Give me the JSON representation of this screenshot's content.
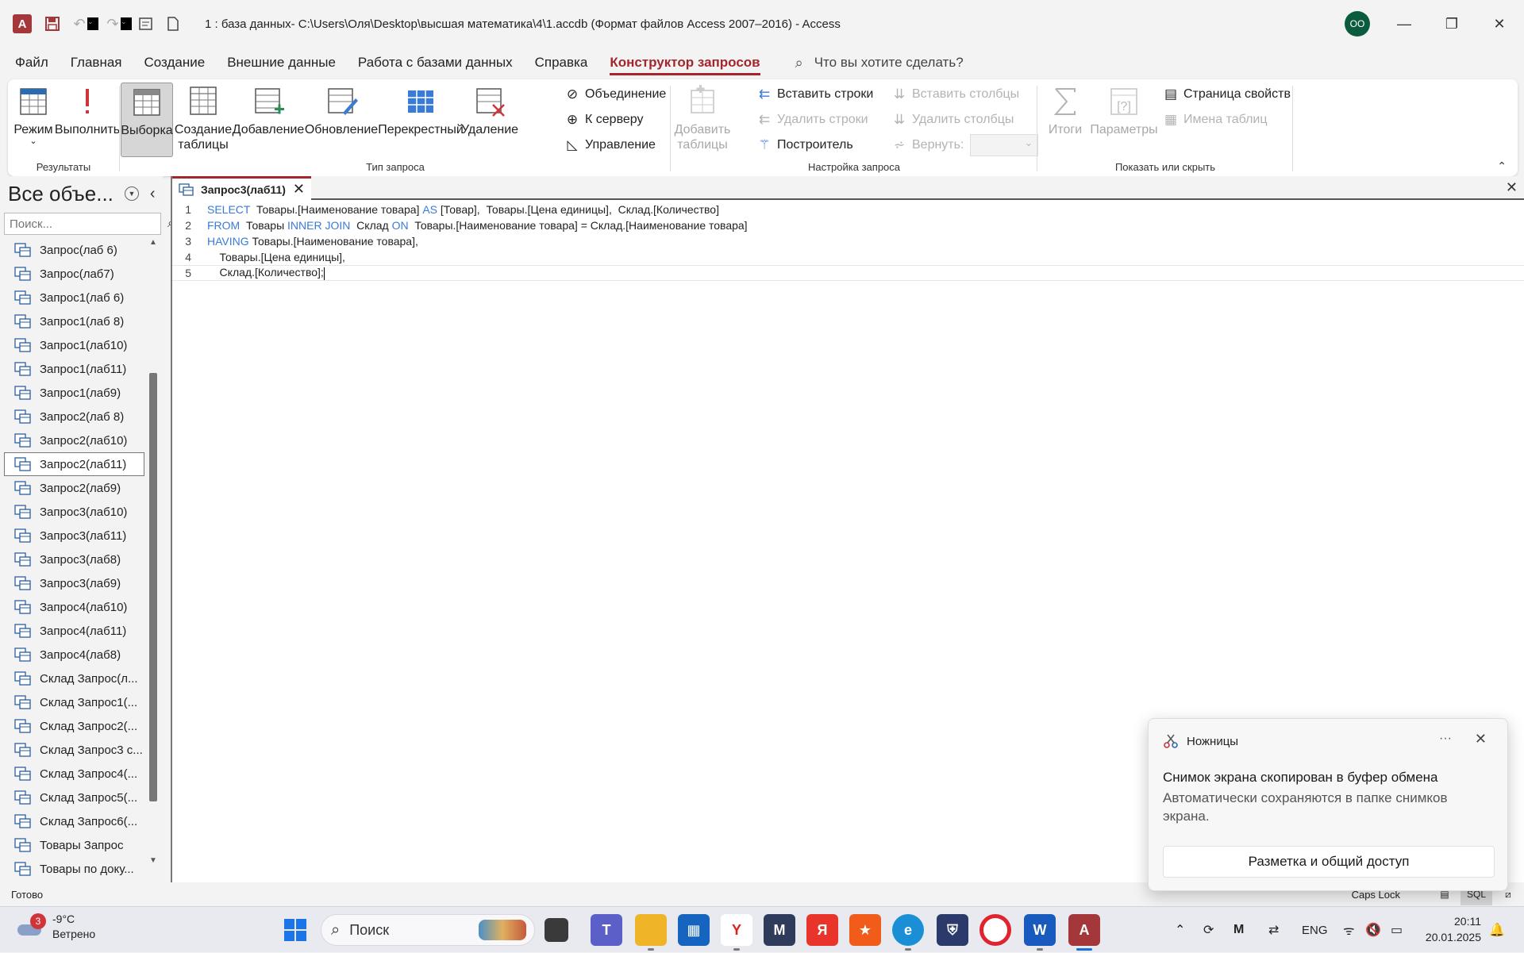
{
  "titlebar": {
    "title": "1 : база данных- C:\\Users\\Оля\\Desktop\\высшая математика\\4\\1.accdb (Формат файлов Access 2007–2016)  -  Access",
    "user_initials": "OO"
  },
  "menu": {
    "tabs": [
      "Файл",
      "Главная",
      "Создание",
      "Внешние данные",
      "Работа с базами данных",
      "Справка",
      "Конструктор запросов"
    ],
    "active_tab": "Конструктор запросов",
    "tell_me": "Что вы хотите сделать?"
  },
  "ribbon": {
    "results": {
      "label": "Результаты",
      "mode": "Режим",
      "run": "Выполнить"
    },
    "query_type": {
      "label": "Тип запроса",
      "select": "Выборка",
      "make_table_1": "Создание",
      "make_table_2": "таблицы",
      "append": "Добавление",
      "update": "Обновление",
      "crosstab": "Перекрестный",
      "delete": "Удаление",
      "union": "Объединение",
      "pass_through": "К серверу",
      "data_definition": "Управление"
    },
    "query_setup": {
      "label": "Настройка запроса",
      "add_tables_1": "Добавить",
      "add_tables_2": "таблицы",
      "insert_rows": "Вставить строки",
      "delete_rows": "Удалить строки",
      "builder": "Построитель",
      "insert_columns": "Вставить столбцы",
      "delete_columns": "Удалить столбцы",
      "return_label": "Вернуть:"
    },
    "show_hide": {
      "label": "Показать или скрыть",
      "totals": "Итоги",
      "parameters": "Параметры",
      "property_sheet": "Страница свойств",
      "table_names": "Имена таблиц"
    }
  },
  "nav": {
    "title": "Все объе...",
    "search_placeholder": "Поиск...",
    "items": [
      "Запрос(лаб 6)",
      "Запрос(лаб7)",
      "Запрос1(лаб 6)",
      "Запрос1(лаб 8)",
      "Запрос1(лаб10)",
      "Запрос1(лаб11)",
      "Запрос1(лаб9)",
      "Запрос2(лаб 8)",
      "Запрос2(лаб10)",
      "Запрос2(лаб11)",
      "Запрос2(лаб9)",
      "Запрос3(лаб10)",
      "Запрос3(лаб11)",
      "Запрос3(лаб8)",
      "Запрос3(лаб9)",
      "Запрос4(лаб10)",
      "Запрос4(лаб11)",
      "Запрос4(лаб8)",
      "Склад Запрос(л...",
      "Склад Запрос1(...",
      "Склад Запрос2(...",
      "Склад Запрос3 с...",
      "Склад Запрос4(...",
      "Склад Запрос5(...",
      "Склад Запрос6(...",
      "Товары Запрос",
      "Товары по доку..."
    ],
    "selected_index": 9
  },
  "document": {
    "tab_title": "Запрос3(лаб11)",
    "lines": [
      {
        "n": "1",
        "parts": [
          [
            "kw",
            "SELECT"
          ],
          [
            "t",
            "  Товары.[Наименование товара] "
          ],
          [
            "kw",
            "AS"
          ],
          [
            "t",
            " [Товар],  Товары.[Цена единицы],  Склад.[Количество]"
          ]
        ]
      },
      {
        "n": "2",
        "parts": [
          [
            "kw",
            "FROM"
          ],
          [
            "t",
            "  Товары "
          ],
          [
            "kw",
            "INNER JOIN"
          ],
          [
            "t",
            "  Склад "
          ],
          [
            "kw",
            "ON"
          ],
          [
            "t",
            "  Товары.[Наименование товара] = Склад.[Наименование товара]"
          ]
        ]
      },
      {
        "n": "3",
        "parts": [
          [
            "kw",
            "HAVING"
          ],
          [
            "t",
            " Товары.[Наименование товара],"
          ]
        ]
      },
      {
        "n": "4",
        "parts": [
          [
            "t",
            "    Товары.[Цена единицы],"
          ]
        ]
      },
      {
        "n": "5",
        "parts": [
          [
            "t",
            "    Склад.[Количество];"
          ]
        ]
      }
    ]
  },
  "status": {
    "ready": "Готово",
    "caps_lock": "Caps Lock",
    "sql_view": "SQL"
  },
  "toast": {
    "app": "Ножницы",
    "more": "···",
    "title": "Снимок экрана скопирован в буфер обмена",
    "body": "Автоматически сохраняются в папке снимков экрана.",
    "button": "Разметка и общий доступ"
  },
  "taskbar": {
    "weather_badge": "3",
    "temperature": "-9°C",
    "weather": "Ветрено",
    "search": "Поиск",
    "language": "ENG",
    "time": "20:11",
    "date": "20.01.2025"
  }
}
